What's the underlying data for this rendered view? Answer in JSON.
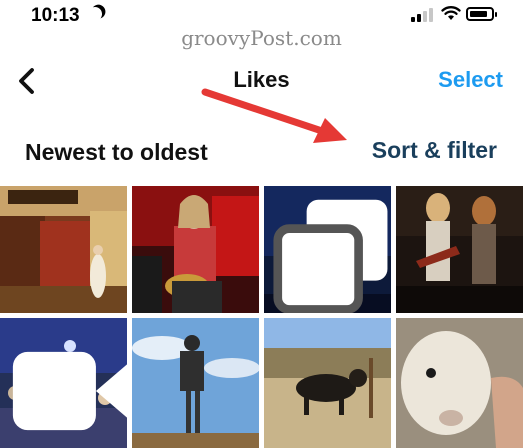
{
  "status_bar": {
    "time": "10:13",
    "signal_bars": 2,
    "battery_level": 0.85
  },
  "watermark": "groovyPost.com",
  "nav": {
    "title": "Likes",
    "select_label": "Select"
  },
  "sort": {
    "label": "Newest to oldest",
    "filter_label": "Sort & filter"
  },
  "annotation": {
    "color": "#e53935"
  },
  "colors": {
    "accent": "#1d9bf0",
    "sort_filter": "#1a3f5c"
  },
  "media": [
    {
      "kind": "photo",
      "badge": ""
    },
    {
      "kind": "photo",
      "badge": ""
    },
    {
      "kind": "photo",
      "badge": "multiple-photos-icon"
    },
    {
      "kind": "photo",
      "badge": ""
    },
    {
      "kind": "video",
      "badge": "video-camera-icon"
    },
    {
      "kind": "photo",
      "badge": ""
    },
    {
      "kind": "photo",
      "badge": ""
    },
    {
      "kind": "photo",
      "badge": ""
    }
  ]
}
